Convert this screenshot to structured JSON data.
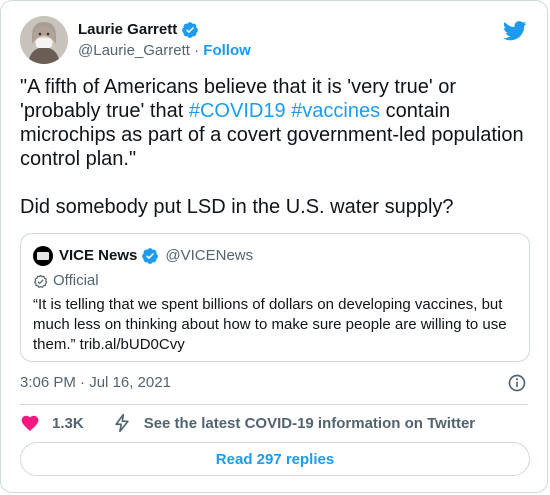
{
  "author": {
    "name": "Laurie Garrett",
    "handle": "@Laurie_Garrett",
    "separator": "·",
    "follow_label": "Follow"
  },
  "tweet": {
    "text_1": "\"A fifth of Americans believe that it is 'very true' or 'probably true' that ",
    "hashtag_1": "#COVID19",
    "space": " ",
    "hashtag_2": "#vaccines",
    "text_2": " contain microchips as part of a covert government-led population control plan.\"\n\nDid somebody put LSD in the U.S. water supply?"
  },
  "quoted": {
    "name": "VICE News",
    "handle": "@VICENews",
    "label": "Official",
    "text": "“It is telling that we spent billions of dollars on developing vaccines, but much less on thinking about how to make sure people are willing to use them.” trib.al/bUD0Cvy"
  },
  "meta": {
    "timestamp": "3:06 PM · Jul 16, 2021"
  },
  "actions": {
    "likes": "1.3K",
    "covid_info": "See the latest COVID-19 information on Twitter"
  },
  "replies_button": "Read 297 replies",
  "colors": {
    "accent": "#1d9bf0",
    "like": "#f91880",
    "muted": "#536471",
    "border": "#cfd9de"
  },
  "icons": [
    "verified-badge-icon",
    "twitter-bird-icon",
    "official-badge-icon",
    "info-icon",
    "heart-icon",
    "lightning-icon"
  ]
}
